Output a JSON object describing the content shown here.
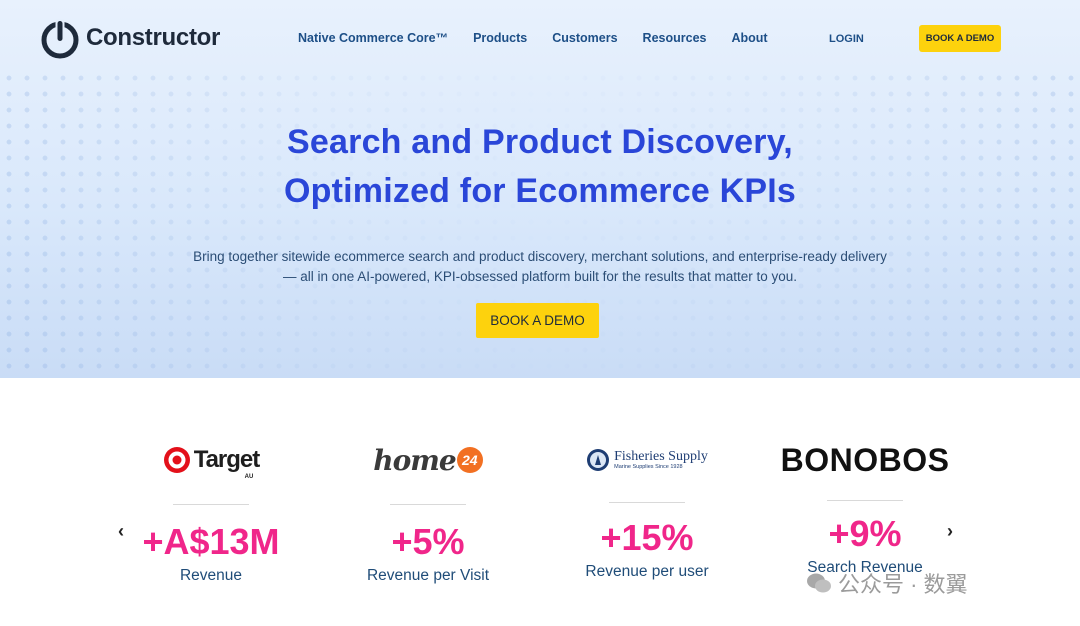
{
  "brand": {
    "name": "Constructor"
  },
  "nav": {
    "items": [
      "Native Commerce Core™",
      "Products",
      "Customers",
      "Resources",
      "About"
    ],
    "login": "LOGIN",
    "demo_button": "BOOK A DEMO"
  },
  "hero": {
    "headline_line1": "Search and Product Discovery,",
    "headline_line2": "Optimized for Ecommerce KPIs",
    "subtext_line1": "Bring together sitewide ecommerce search and product discovery, merchant solutions, and enterprise-ready delivery",
    "subtext_line2": "— all in one AI-powered, KPI-obsessed platform built for the results that matter to you.",
    "cta": "BOOK A DEMO"
  },
  "stats": [
    {
      "brand": "Target",
      "brand_sub": "AU",
      "value": "+A$13M",
      "label": "Revenue"
    },
    {
      "brand": "home",
      "brand_badge": "24",
      "value": "+5%",
      "label": "Revenue per Visit"
    },
    {
      "brand": "Fisheries Supply",
      "brand_tagline": "Marine Supplies Since 1928",
      "value": "+15%",
      "label": "Revenue per user"
    },
    {
      "brand": "BONOBOS",
      "value": "+9%",
      "label": "Search Revenue"
    }
  ],
  "carousel": {
    "prev": "‹",
    "next": "›"
  },
  "watermark": {
    "text": "公众号 · 数翼"
  },
  "colors": {
    "accent_blue": "#2a46d8",
    "cta_yellow": "#fdd20d",
    "stat_pink": "#f0268a",
    "nav_text": "#1d4f87"
  }
}
